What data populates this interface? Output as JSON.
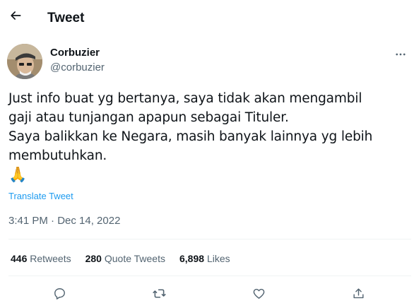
{
  "header": {
    "title": "Tweet",
    "back_icon": "arrow-left-icon"
  },
  "author": {
    "name": "Corbuzier",
    "handle": "@corbuzier",
    "avatar": "avatar-photo"
  },
  "tweet": {
    "text": "Just info buat yg bertanya, saya tidak akan mengambil\ngaji atau tunjangan apapun sebagai Tituler.\nSaya balikkan ke Negara, masih banyak lainnya yg lebih\nmembutuhkan.",
    "emoji": "🙏",
    "translate_label": "Translate Tweet",
    "timestamp": "3:41 PM · Dec 14, 2022"
  },
  "stats": [
    {
      "count": "446",
      "label": "Retweets"
    },
    {
      "count": "280",
      "label": "Quote Tweets"
    },
    {
      "count": "6,898",
      "label": "Likes"
    }
  ],
  "actions": [
    "reply-icon",
    "retweet-icon",
    "like-icon",
    "share-icon"
  ],
  "colors": {
    "accent": "#1d9bf0",
    "text": "#0f1419",
    "muted": "#536471",
    "divider": "#eff3f4"
  }
}
